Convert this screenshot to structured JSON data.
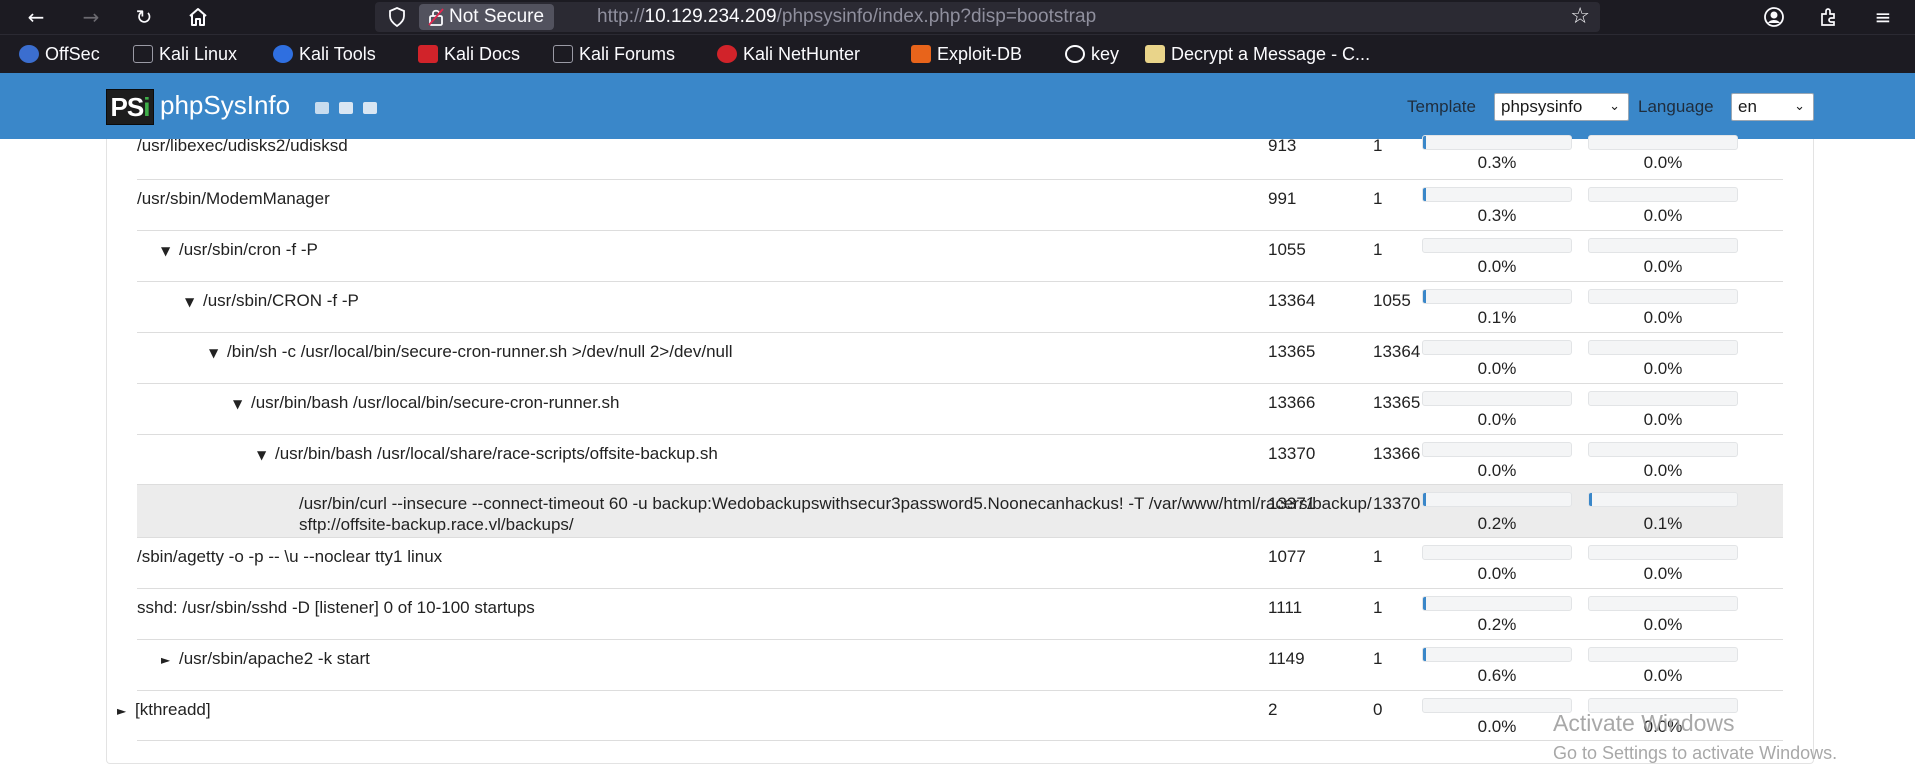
{
  "browser": {
    "security_label": "Not Secure",
    "url_prefix": "http://",
    "url_host": "10.129.234.209",
    "url_path": "/phpsysinfo/index.php?disp=bootstrap"
  },
  "bookmarks": [
    {
      "label": "OffSec",
      "icon": "offsec-icon",
      "color": "#3b6ecf"
    },
    {
      "label": "Kali Linux",
      "icon": "kali-dragon-icon",
      "color": "#1c1b22"
    },
    {
      "label": "Kali Tools",
      "icon": "kali-tools-icon",
      "color": "#2f6fe0"
    },
    {
      "label": "Kali Docs",
      "icon": "kali-docs-icon",
      "color": "#d1232a"
    },
    {
      "label": "Kali Forums",
      "icon": "kali-forums-icon",
      "color": "#1c1b22"
    },
    {
      "label": "Kali NetHunter",
      "icon": "nethunter-icon",
      "color": "#d1232a"
    },
    {
      "label": "Exploit-DB",
      "icon": "exploitdb-icon",
      "color": "#e8641b"
    },
    {
      "label": "key",
      "icon": "globe-icon",
      "color": "#1c1b22"
    },
    {
      "label": "Decrypt a Message - C...",
      "icon": "decrypt-icon",
      "color": "#e9d48a"
    }
  ],
  "header": {
    "logo_ps": "PS",
    "logo_i": "i",
    "title": "phpSysInfo",
    "template_label": "Template",
    "template_value": "phpsysinfo",
    "language_label": "Language",
    "language_value": "en",
    "accent": "#3a87c9"
  },
  "processes": [
    {
      "command": "/usr/libexec/udisks2/udisksd",
      "pid": "913",
      "ppid": "1",
      "mem": "0.3%",
      "cpu": "0.0%",
      "mem_fill": 0.3,
      "cpu_fill": 0.0,
      "indent": 0,
      "toggle": ""
    },
    {
      "command": "/usr/sbin/ModemManager",
      "pid": "991",
      "ppid": "1",
      "mem": "0.3%",
      "cpu": "0.0%",
      "mem_fill": 0.3,
      "cpu_fill": 0.0,
      "indent": 0,
      "toggle": ""
    },
    {
      "command": "/usr/sbin/cron -f -P",
      "pid": "1055",
      "ppid": "1",
      "mem": "0.0%",
      "cpu": "0.0%",
      "mem_fill": 0.0,
      "cpu_fill": 0.0,
      "indent": 1,
      "toggle": "▼"
    },
    {
      "command": "/usr/sbin/CRON -f -P",
      "pid": "13364",
      "ppid": "1055",
      "mem": "0.1%",
      "cpu": "0.0%",
      "mem_fill": 0.1,
      "cpu_fill": 0.0,
      "indent": 2,
      "toggle": "▼"
    },
    {
      "command": "/bin/sh -c /usr/local/bin/secure-cron-runner.sh >/dev/null 2>/dev/null",
      "pid": "13365",
      "ppid": "13364",
      "mem": "0.0%",
      "cpu": "0.0%",
      "mem_fill": 0.0,
      "cpu_fill": 0.0,
      "indent": 3,
      "toggle": "▼"
    },
    {
      "command": "/usr/bin/bash /usr/local/bin/secure-cron-runner.sh",
      "pid": "13366",
      "ppid": "13365",
      "mem": "0.0%",
      "cpu": "0.0%",
      "mem_fill": 0.0,
      "cpu_fill": 0.0,
      "indent": 4,
      "toggle": "▼"
    },
    {
      "command": "/usr/bin/bash /usr/local/share/race-scripts/offsite-backup.sh",
      "pid": "13370",
      "ppid": "13366",
      "mem": "0.0%",
      "cpu": "0.0%",
      "mem_fill": 0.0,
      "cpu_fill": 0.0,
      "indent": 5,
      "toggle": "▼"
    },
    {
      "command": "/usr/bin/curl --insecure --connect-timeout 60 -u backup:Wedobackupswithsecur3password5.Noonecanhackus! -T /var/www/html/racers/backup/ sftp://offsite-backup.race.vl/backups/",
      "pid": "13371",
      "ppid": "13370",
      "mem": "0.2%",
      "cpu": "0.1%",
      "mem_fill": 0.2,
      "cpu_fill": 0.1,
      "indent": 6,
      "toggle": ""
    },
    {
      "command": "/sbin/agetty -o -p -- \\u --noclear tty1 linux",
      "pid": "1077",
      "ppid": "1",
      "mem": "0.0%",
      "cpu": "0.0%",
      "mem_fill": 0.0,
      "cpu_fill": 0.0,
      "indent": 0,
      "toggle": ""
    },
    {
      "command": "sshd: /usr/sbin/sshd -D [listener] 0 of 10-100 startups",
      "pid": "1111",
      "ppid": "1",
      "mem": "0.2%",
      "cpu": "0.0%",
      "mem_fill": 0.2,
      "cpu_fill": 0.0,
      "indent": 0,
      "toggle": ""
    },
    {
      "command": "/usr/sbin/apache2 -k start",
      "pid": "1149",
      "ppid": "1",
      "mem": "0.6%",
      "cpu": "0.0%",
      "mem_fill": 0.6,
      "cpu_fill": 0.0,
      "indent": 1,
      "toggle": "►"
    },
    {
      "command": "[kthreadd]",
      "pid": "2",
      "ppid": "0",
      "mem": "0.0%",
      "cpu": "0.0%",
      "mem_fill": 0.0,
      "cpu_fill": 0.0,
      "indent": -1,
      "toggle": "►"
    }
  ],
  "watermark": {
    "line1": "Activate Windows",
    "line2": "Go to Settings to activate Windows."
  }
}
